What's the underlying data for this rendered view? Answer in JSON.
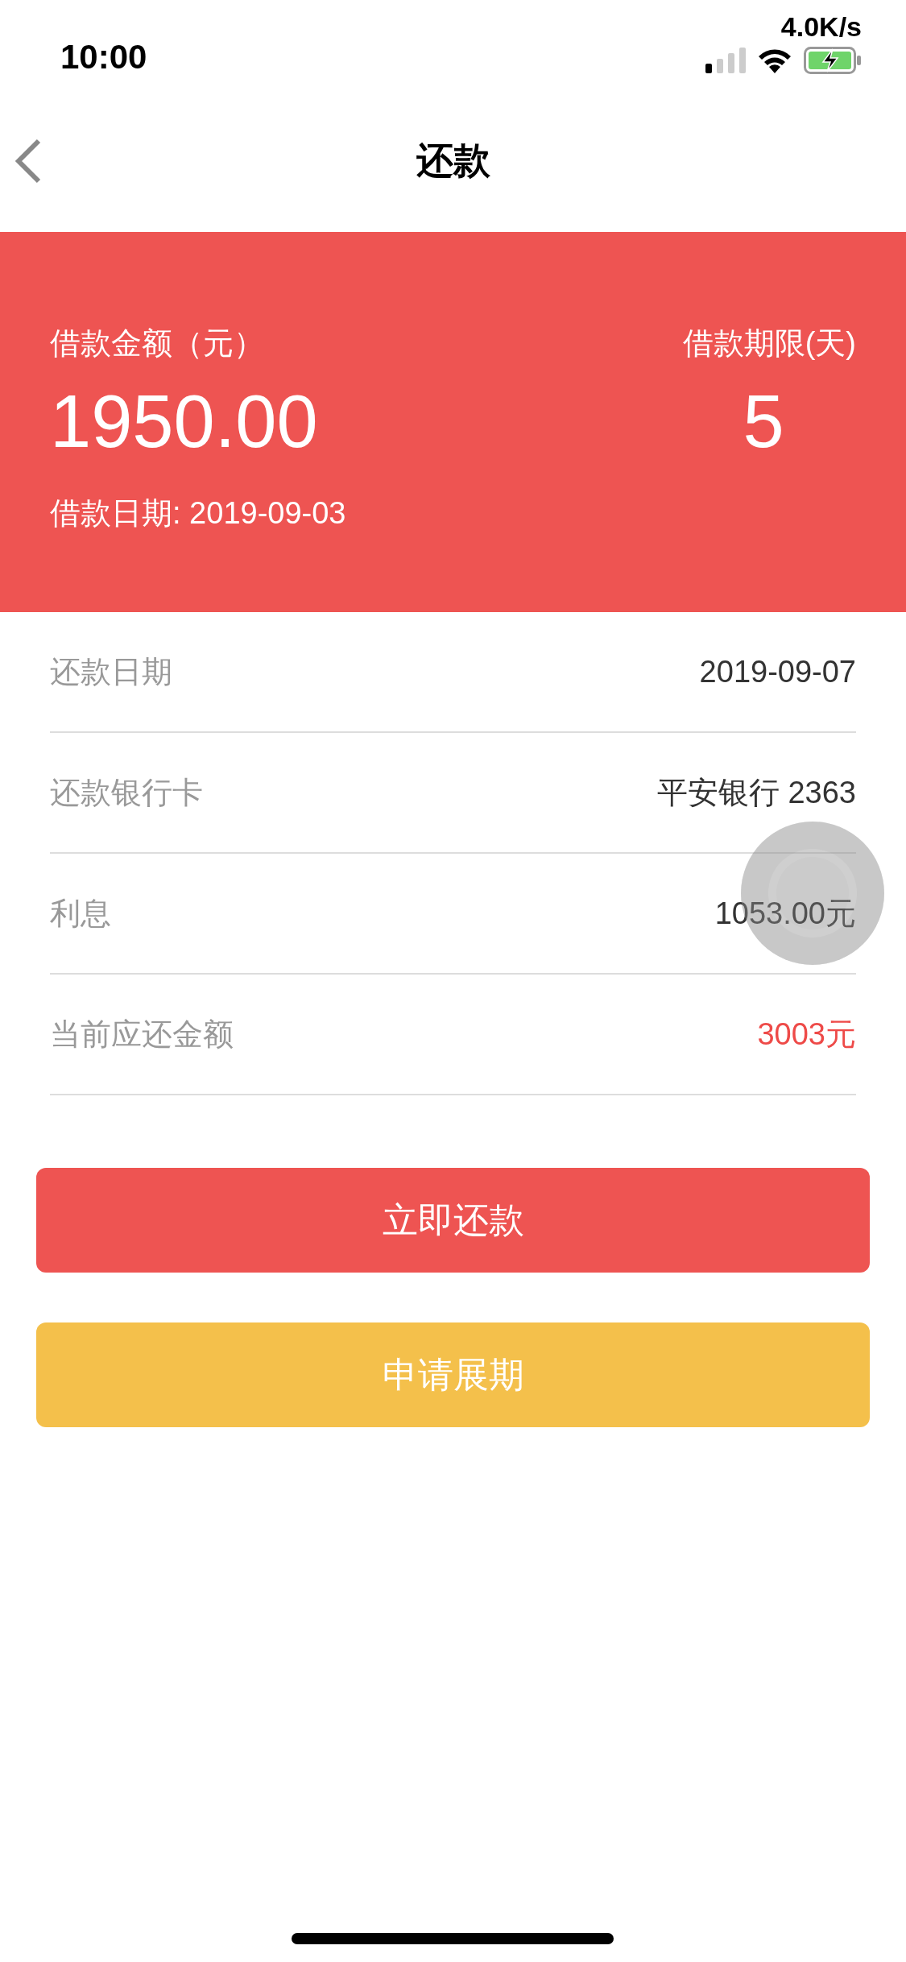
{
  "status_bar": {
    "time": "10:00",
    "speed": "4.0K/s"
  },
  "nav": {
    "title": "还款"
  },
  "loan": {
    "amount_label": "借款金额（元）",
    "amount": "1950.00",
    "term_label": "借款期限(天)",
    "term": "5",
    "date": "借款日期: 2019-09-03"
  },
  "rows": [
    {
      "label": "还款日期",
      "value": "2019-09-07",
      "kind": "plain"
    },
    {
      "label": "还款银行卡",
      "value": "平安银行 2363",
      "kind": "plain"
    },
    {
      "label": "利息",
      "value": "1053.00元",
      "kind": "plain"
    },
    {
      "label": "当前应还金额",
      "value": "3003元",
      "kind": "due"
    }
  ],
  "buttons": [
    {
      "label": "立即还款",
      "kind": "primary"
    },
    {
      "label": "申请展期",
      "kind": "secondary"
    }
  ]
}
